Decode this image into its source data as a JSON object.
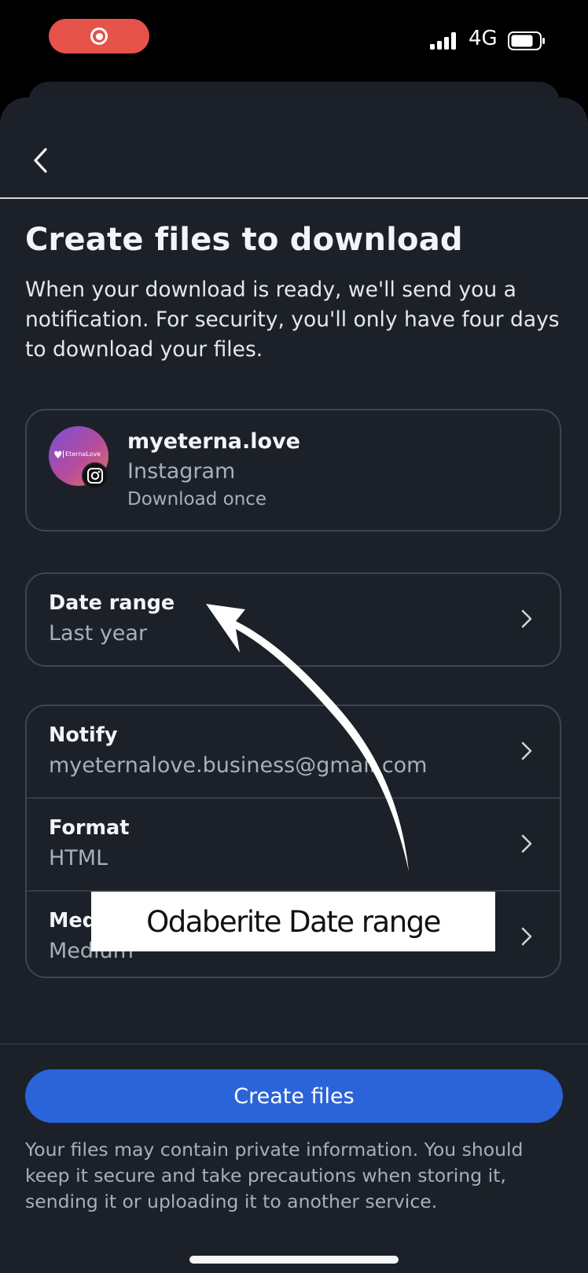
{
  "status_bar": {
    "network": "4G"
  },
  "header": {
    "back_icon": "chevron-left-icon"
  },
  "page": {
    "title": "Create files to download",
    "description": "When your download is ready, we'll send you a notification. For security, you'll only have four days to download your files."
  },
  "account": {
    "name": "myeterna.love",
    "platform": "Instagram",
    "note": "Download once",
    "avatar_brand": "EternaLove"
  },
  "settings": {
    "date_range": {
      "label": "Date range",
      "value": "Last year"
    },
    "notify": {
      "label": "Notify",
      "value": "myeternalove.business@gmail.com"
    },
    "format": {
      "label": "Format",
      "value": "HTML"
    },
    "media_quality": {
      "label": "Media quality",
      "value": "Medium"
    }
  },
  "footer": {
    "create_label": "Create files",
    "disclaimer": "Your files may contain private information. You should keep it secure and take precautions when storing it, sending it or uploading it to another service."
  },
  "overlay": {
    "caption": "Odaberite Date range"
  },
  "colors": {
    "background": "#1c2129",
    "accent": "#2b63d9",
    "record": "#e5534b",
    "border": "#3d4552"
  }
}
